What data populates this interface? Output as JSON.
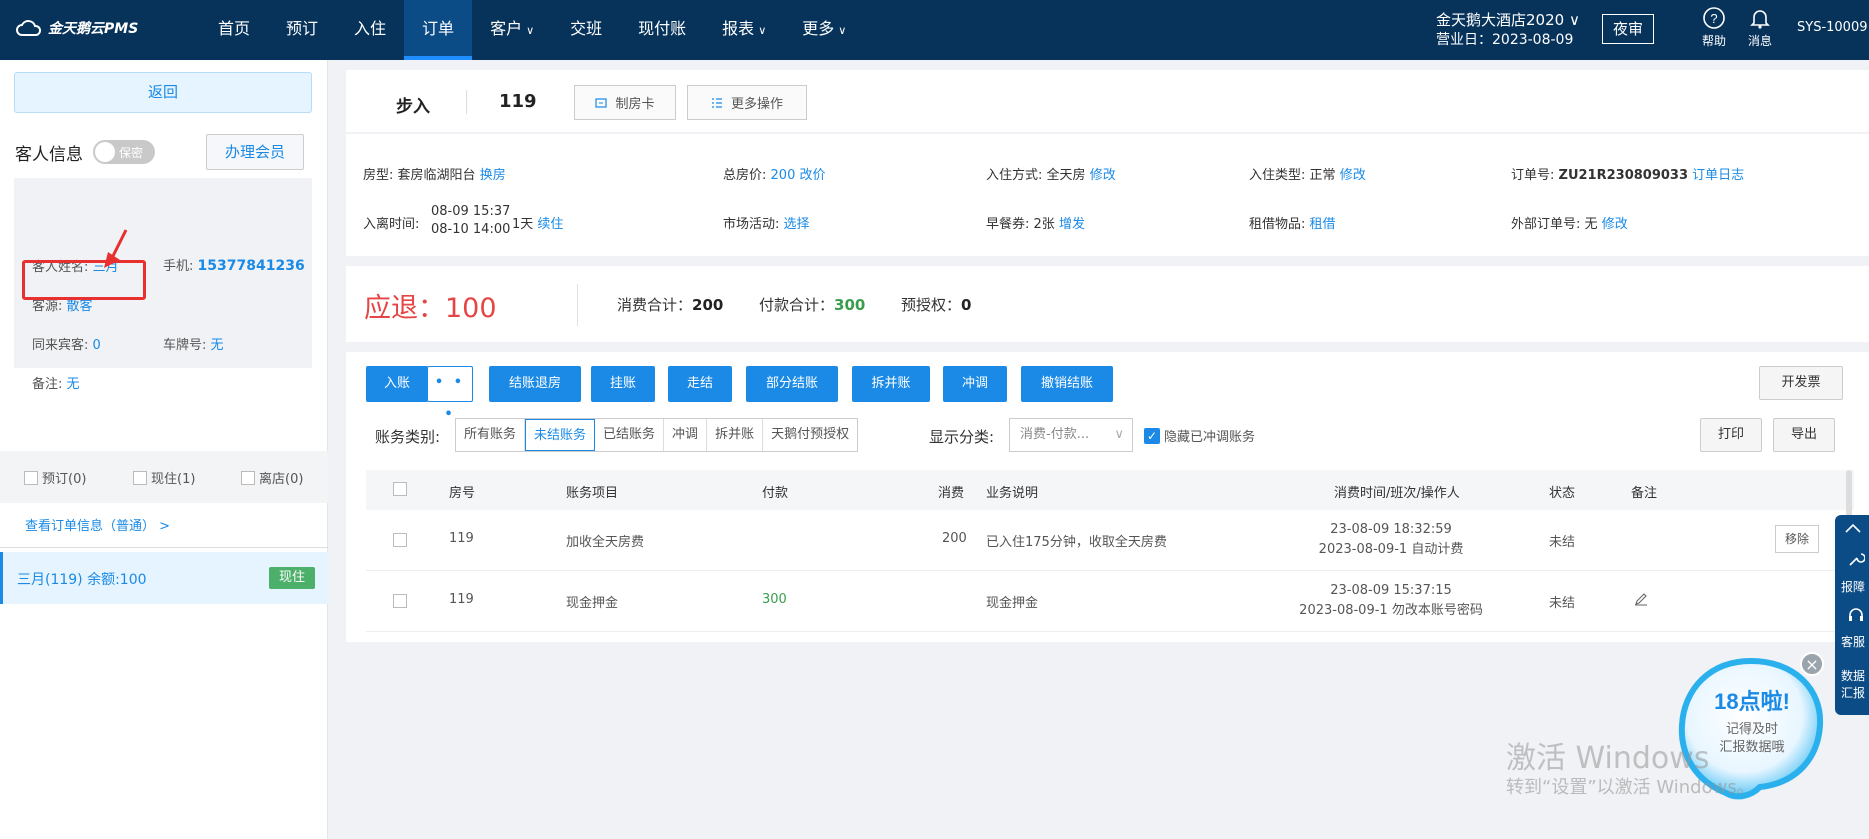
{
  "app": {
    "logo_text": "金天鹅云PMS"
  },
  "nav": {
    "items": [
      {
        "label": "首页",
        "chev": ""
      },
      {
        "label": "预订",
        "chev": ""
      },
      {
        "label": "入住",
        "chev": ""
      },
      {
        "label": "订单",
        "chev": ""
      },
      {
        "label": "客户",
        "chev": "∨"
      },
      {
        "label": "交班",
        "chev": ""
      },
      {
        "label": "现付账",
        "chev": ""
      },
      {
        "label": "报表",
        "chev": "∨"
      },
      {
        "label": "更多",
        "chev": "∨"
      }
    ],
    "active_index": 3
  },
  "header": {
    "hotel_name": "金天鹅大酒店2020 ∨",
    "business_date": "营业日：2023-08-09",
    "night_audit": "夜审",
    "help": "帮助",
    "messages": "消息",
    "user_id": "SYS-10009"
  },
  "left": {
    "back": "返回",
    "guest_title": "客人信息",
    "privacy_toggle": "保密",
    "member_btn": "办理会员",
    "guest": {
      "name_label": "客人姓名:",
      "name": "三月",
      "phone_label": "手机:",
      "phone": "15377841236",
      "source_label": "客源:",
      "source": "散客",
      "companion_label": "同来宾客:",
      "companion": "0",
      "plate_label": "车牌号:",
      "plate": "无",
      "remark_label": "备注:",
      "remark": "无"
    },
    "filters": [
      "预订(0)",
      "现住(1)",
      "离店(0)"
    ],
    "view_order": "查看订单信息（普通）  >",
    "room_row": {
      "text": "三月(119)   余额:100",
      "tag": "现住"
    }
  },
  "order": {
    "type": "步入",
    "room": "119",
    "make_card": "制房卡",
    "more_ops": "更多操作"
  },
  "info": {
    "room_type_label": "房型:",
    "room_type": "套房临湖阳台",
    "change_room": "换房",
    "total_label": "总房价:",
    "total": "200",
    "change_price": "改价",
    "checkin_mode_label": "入住方式:",
    "checkin_mode": "全天房",
    "modify1": "修改",
    "checkin_type_label": "入住类型:",
    "checkin_type": "正常",
    "modify2": "修改",
    "order_no_label": "订单号:",
    "order_no": "ZU21R230809033",
    "order_log": "订单日志",
    "time_label": "入离时间:",
    "time_in": "08-09 15:37",
    "time_out": "08-10 14:00",
    "days": "1天",
    "extend": "续住",
    "market_label": "市场活动:",
    "market": "选择",
    "breakfast_label": "早餐券:",
    "breakfast": "2张",
    "breakfast_add": "增发",
    "borrow_label": "租借物品:",
    "borrow": "租借",
    "ext_order_label": "外部订单号:",
    "ext_order": "无",
    "modify3": "修改"
  },
  "amount": {
    "refund_label": "应退：",
    "refund": "100",
    "consume_label": "消费合计：",
    "consume": "200",
    "pay_label": "付款合计：",
    "pay": "300",
    "preauth_label": "预授权：",
    "preauth": "0"
  },
  "toolbar": {
    "post": "入账",
    "more": "• • •",
    "checkout": "结账退房",
    "hang": "挂账",
    "walkout": "走结",
    "partial": "部分结账",
    "split": "拆并账",
    "reverse": "冲调",
    "cancel_checkout": "撤销结账",
    "invoice": "开发票",
    "print": "打印",
    "export": "导出"
  },
  "filter": {
    "acct_label": "账务类别:",
    "acct_options": [
      "所有账务",
      "未结账务",
      "已结账务",
      "冲调",
      "拆并账",
      "天鹅付预授权"
    ],
    "acct_selected": 1,
    "show_label": "显示分类:",
    "show_value": "消费-付款...",
    "hide_reversed": "隐藏已冲调账务"
  },
  "table": {
    "headers": [
      "房号",
      "账务项目",
      "付款",
      "消费",
      "业务说明",
      "消费时间/班次/操作人",
      "状态",
      "备注"
    ],
    "rows": [
      {
        "room": "119",
        "item": "加收全天房费",
        "pay": "",
        "consume": "200",
        "desc": "已入住175分钟，收取全天房费",
        "time1": "23-08-09 18:32:59",
        "time2": "2023-08-09-1 自动计费",
        "status": "未结",
        "action": "移除"
      },
      {
        "room": "119",
        "item": "现金押金",
        "pay": "300",
        "consume": "",
        "desc": "现金押金",
        "time1": "23-08-09 15:37:15",
        "time2": "2023-08-09-1 勿改本账号密码",
        "status": "未结",
        "action": ""
      }
    ]
  },
  "side_tools": {
    "report": "报障",
    "service": "客服",
    "data1": "数据",
    "data2": "汇报"
  },
  "promo": {
    "title": "18点啦!",
    "line1": "记得及时",
    "line2": "汇报数据哦"
  },
  "watermark": {
    "line1": "激活 Windows",
    "line2": "转到“设置”以激活 Windows。"
  },
  "colors": {
    "nav_bg": "#07335b",
    "accent": "#1a8ae6",
    "refund": "#e64545",
    "pay_green": "#3a9d4d",
    "tag_green": "#4caf6a"
  }
}
